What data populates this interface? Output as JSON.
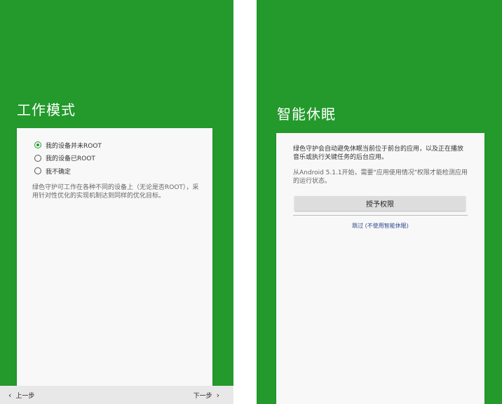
{
  "colors": {
    "primary_green": "#239a2b",
    "card_bg": "#f8f8f8",
    "link_blue": "#2f4c8f"
  },
  "left_screen": {
    "title": "工作模式",
    "options": [
      {
        "label": "我的设备并未ROOT",
        "checked": true
      },
      {
        "label": "我的设备已ROOT",
        "checked": false
      },
      {
        "label": "我不确定",
        "checked": false
      }
    ],
    "description": "绿色守护可工作在各种不同的设备上（无论是否ROOT），采用针对性优化的实现机制达到同样的优化目标。",
    "nav": {
      "prev_label": "上一步",
      "next_label": "下一步",
      "prev_icon": "chevron-left-icon",
      "next_icon": "chevron-right-icon"
    }
  },
  "right_screen": {
    "title": "智能休眠",
    "description_1": "绿色守护会自动避免休眠当前位于前台的应用，以及正在播放音乐或执行关键任务的后台应用。",
    "description_2": "从Android 5.1.1开始，需要\"应用使用情况\"权限才能检测应用的运行状态。",
    "grant_button": "授予权限",
    "skip_link": "跳过 (不使用智能休眠)"
  }
}
